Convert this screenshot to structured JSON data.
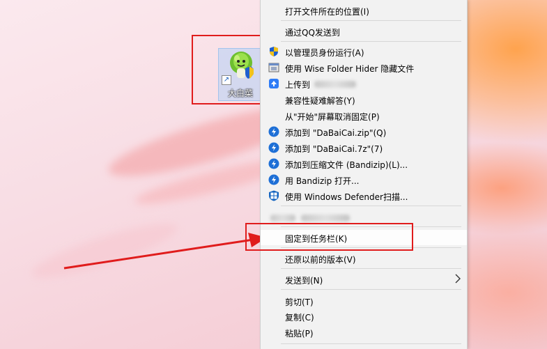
{
  "desktop": {
    "icon": {
      "label": "大白菜",
      "name": "DaBaiCai"
    }
  },
  "context_menu": {
    "items": [
      {
        "label": "打开文件所在的位置(I)"
      },
      {
        "label": "通过QQ发送到"
      },
      {
        "label": "以管理员身份运行(A)",
        "icon": "uac-shield-icon"
      },
      {
        "label": "使用 Wise Folder Hider 隐藏文件",
        "icon": "wise-folder-hider-icon"
      },
      {
        "label": "上传到",
        "icon": "cloud-upload-icon",
        "blurred": true
      },
      {
        "label": "兼容性疑难解答(Y)"
      },
      {
        "label": "从\"开始\"屏幕取消固定(P)"
      },
      {
        "label": "添加到 \"DaBaiCai.zip\"(Q)",
        "icon": "bandizip-icon"
      },
      {
        "label": "添加到 \"DaBaiCai.7z\"(7)",
        "icon": "bandizip-icon"
      },
      {
        "label": "添加到压缩文件 (Bandizip)(L)...",
        "icon": "bandizip-icon"
      },
      {
        "label": "用 Bandizip 打开...",
        "icon": "bandizip-icon"
      },
      {
        "label": "使用 Windows Defender扫描...",
        "icon": "windows-defender-icon"
      },
      {
        "label": "",
        "blurred": true
      },
      {
        "label": "固定到任务栏(K)"
      },
      {
        "label": "还原以前的版本(V)"
      },
      {
        "label": "发送到(N)",
        "submenu": true
      },
      {
        "label": "剪切(T)"
      },
      {
        "label": "复制(C)"
      },
      {
        "label": "粘贴(P)"
      }
    ]
  },
  "colors": {
    "annotation_red": "#e01c1c",
    "menu_bg": "#f2f2f2",
    "bandizip_blue": "#1e6fd6"
  }
}
